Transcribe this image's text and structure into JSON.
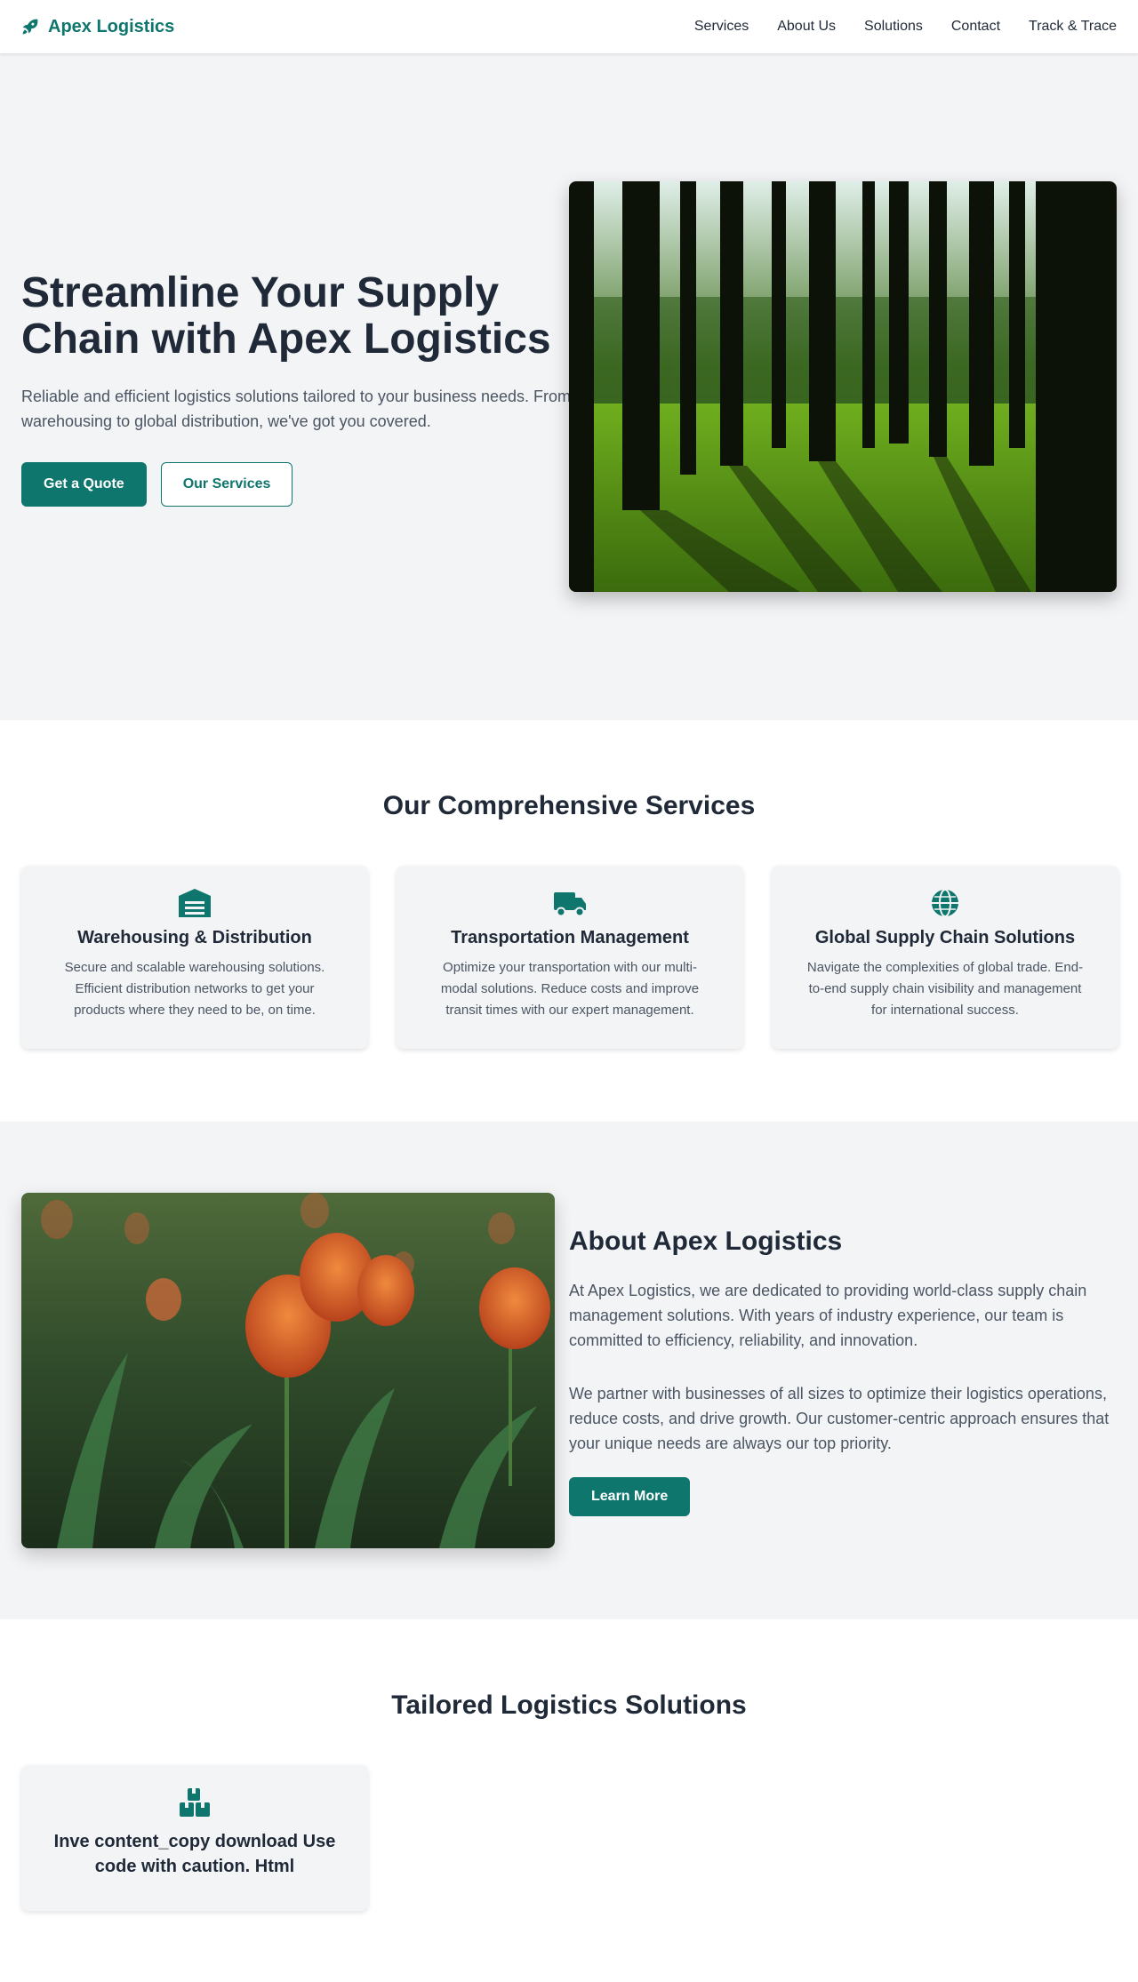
{
  "header": {
    "brand": "Apex Logistics",
    "nav": [
      "Services",
      "About Us",
      "Solutions",
      "Contact",
      "Track & Trace"
    ]
  },
  "hero": {
    "title": "Streamline Your Supply Chain with Apex Logistics",
    "subtitle": "Reliable and efficient logistics solutions tailored to your business needs. From warehousing to global distribution, we've got you covered.",
    "primary_button": "Get a Quote",
    "secondary_button": "Our Services",
    "image_icon": "forest-photo"
  },
  "services": {
    "title": "Our Comprehensive Services",
    "cards": [
      {
        "icon": "warehouse-icon",
        "title": "Warehousing & Distribution",
        "text": "Secure and scalable warehousing solutions. Efficient distribution networks to get your products where they need to be, on time."
      },
      {
        "icon": "truck-icon",
        "title": "Transportation Management",
        "text": "Optimize your transportation with our multi-modal solutions. Reduce costs and improve transit times with our expert management."
      },
      {
        "icon": "globe-icon",
        "title": "Global Supply Chain Solutions",
        "text": "Navigate the complexities of global trade. End-to-end supply chain visibility and management for international success."
      }
    ]
  },
  "about": {
    "title": "About Apex Logistics",
    "p1": "At Apex Logistics, we are dedicated to providing world-class supply chain management solutions. With years of industry experience, our team is committed to efficiency, reliability, and innovation.",
    "p2": "We partner with businesses of all sizes to optimize their logistics operations, reduce costs, and drive growth. Our customer-centric approach ensures that your unique needs are always our top priority.",
    "button": "Learn More",
    "image_icon": "tulips-photo"
  },
  "solutions": {
    "title": "Tailored Logistics Solutions",
    "card": {
      "icon": "boxes-icon",
      "title": "Inve content_copy download Use code with caution. Html"
    }
  },
  "colors": {
    "accent": "#0f766e",
    "text_dark": "#1f2937",
    "text_muted": "#4b5563",
    "section_bg": "#f3f4f6"
  }
}
